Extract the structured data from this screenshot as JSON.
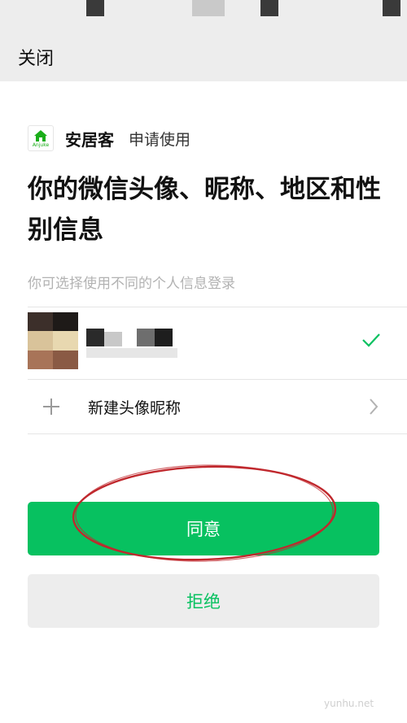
{
  "header": {
    "close_label": "关闭"
  },
  "app": {
    "name": "安居客",
    "action": "申请使用",
    "logo_text": "Anjuke",
    "logo_color": "#1aad19"
  },
  "title": "你的微信头像、昵称、地区和性别信息",
  "subtitle": "你可选择使用不同的个人信息登录",
  "profile": {
    "nickname": "",
    "selected": true
  },
  "new_profile": {
    "label": "新建头像昵称"
  },
  "buttons": {
    "agree": "同意",
    "reject": "拒绝"
  },
  "colors": {
    "accent": "#07c160",
    "annotation": "#c0282d"
  },
  "watermark": "yunhu.net"
}
